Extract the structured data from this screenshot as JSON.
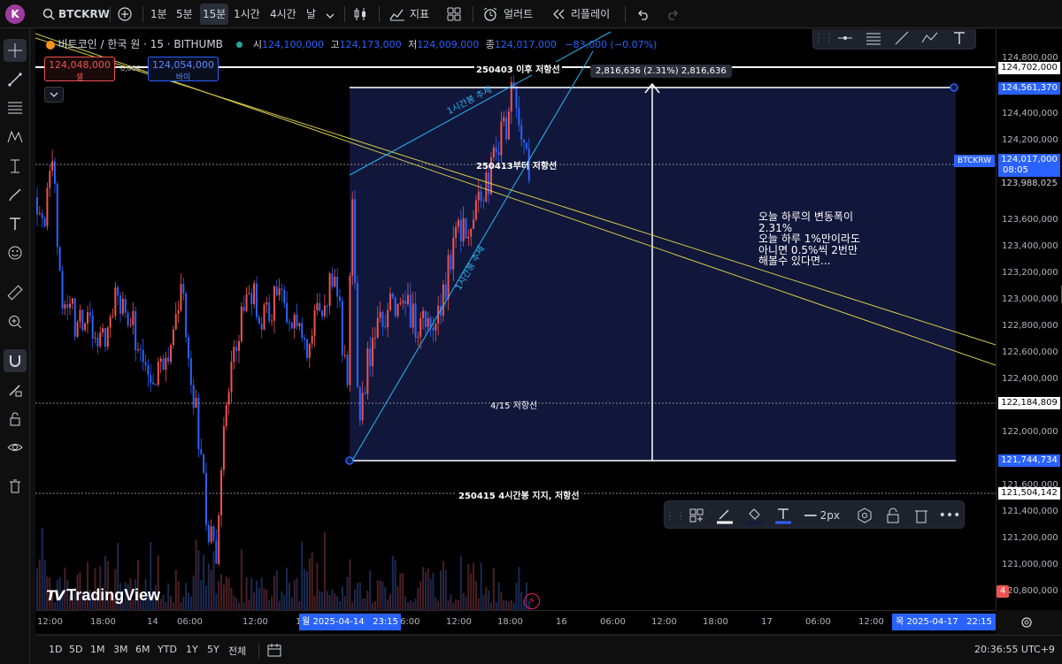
{
  "topbar": {
    "avatar": "K",
    "symbol": "BTCKRW",
    "intervals": [
      "1분",
      "5분",
      "15분",
      "1시간",
      "4시간",
      "날"
    ],
    "active_interval": "15분",
    "indicators_label": "지표",
    "alert_label": "얼러트",
    "replay_label": "리플레이"
  },
  "legend": {
    "title": "비트코인 / 한국 원 · 15 · BITHUMB",
    "open_label": "시",
    "open": "124,100,000",
    "high_label": "고",
    "high": "124,173,000",
    "low_label": "저",
    "low": "124,009,000",
    "close_label": "종",
    "close": "124,017,000",
    "change": "−83,000 (−0.07%)",
    "sell_price": "124,048,000",
    "sell_label": "셀",
    "spread": "6,000",
    "buy_price": "124,054,000",
    "buy_label": "바이"
  },
  "annotations": {
    "line_250403": "250403 이후 저항선",
    "measure": "2,816,636 (2.31%) 2,816,636",
    "trend_1h_top": "1시간봉 추세",
    "trend_1h_bottom": "1시간봉 추세",
    "line_250413": "250413부터 저항선",
    "note_line1": "오늘 하루의 변동폭이",
    "note_line2": "2.31%",
    "note_line3": "오늘 하루 1%만이라도",
    "note_line4": "아니면 0.5%씩 2번만",
    "note_line5": "해볼수 있다면...",
    "line_415": "4/15 저항선",
    "line_250415": "250415 4시간봉 지지, 저항선",
    "watermark": "TradingView"
  },
  "price_axis": {
    "labels": [
      "124,800,000",
      "124,400,000",
      "124,200,000",
      "123,600,000",
      "123,400,000",
      "123,200,000",
      "123,000,000",
      "122,800,000",
      "122,600,000",
      "122,400,000",
      "122,000,000",
      "121,800,000",
      "121,600,000",
      "121,400,000",
      "121,200,000",
      "121,000,000",
      "120,800,000"
    ],
    "tag_702": "124,702,000",
    "tag_561": "124,561,370",
    "tag_symbol": "BTCKRW",
    "tag_current": "124,017,000",
    "tag_countdown": "08:05",
    "tag_988": "123,988,025",
    "tag_184": "122,184,809",
    "tag_744": "121,744,734",
    "tag_504": "121,504,142",
    "alert_badge": "4"
  },
  "time_axis": {
    "labels": [
      "12:00",
      "18:00",
      "14",
      "06:00",
      "12:00",
      "18:00",
      "6:00",
      "12:00",
      "18:00",
      "16",
      "06:00",
      "12:00",
      "18:00",
      "17",
      "06:00",
      "12:00"
    ],
    "crosshair_start": "월 2025-04-14   23:15",
    "crosshair_end": "목 2025-04-17   22:15"
  },
  "bottombar": {
    "ranges": [
      "1D",
      "5D",
      "1M",
      "3M",
      "6M",
      "YTD",
      "1Y",
      "5Y",
      "전체"
    ],
    "clock": "20:36:55 UTC+9"
  },
  "drawbar": {
    "width_label": "2px"
  },
  "colors": {
    "up": "#ef5350",
    "down": "#2962ff",
    "box_fill": "#131a40",
    "trend": "#29b6f6",
    "yellow": "#d4c94a"
  }
}
